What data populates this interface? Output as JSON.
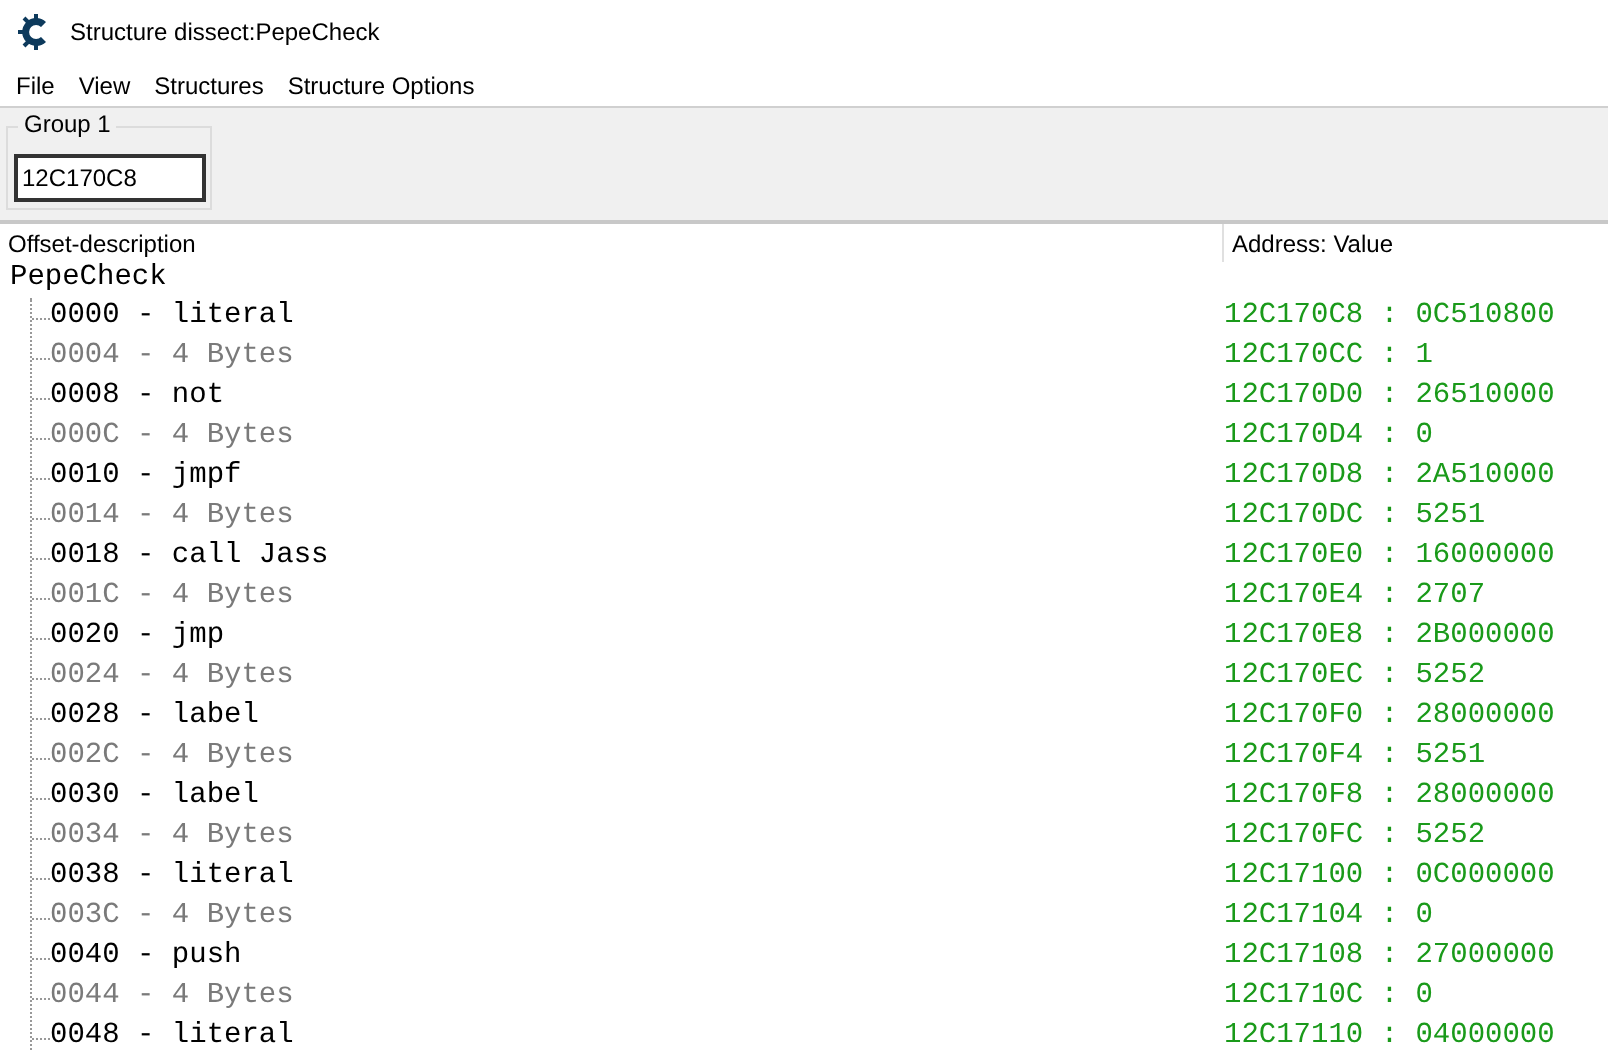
{
  "window": {
    "title": "Structure dissect:PepeCheck"
  },
  "menu": [
    "File",
    "View",
    "Structures",
    "Structure Options"
  ],
  "group": {
    "title": "Group 1",
    "address": "12C170C8"
  },
  "columns": [
    "Offset-description",
    "Address: Value"
  ],
  "tree": {
    "label": "PepeCheck",
    "children": [
      {
        "kind": "field",
        "label": "0000 - literal",
        "value": "12C170C8 : 0C510800"
      },
      {
        "kind": "padding",
        "label": "0004 - 4 Bytes",
        "value": "12C170CC : 1"
      },
      {
        "kind": "field",
        "label": "0008 - not",
        "value": "12C170D0 : 26510000"
      },
      {
        "kind": "padding",
        "label": "000C - 4 Bytes",
        "value": "12C170D4 : 0"
      },
      {
        "kind": "field",
        "label": "0010 - jmpf",
        "value": "12C170D8 : 2A510000"
      },
      {
        "kind": "padding",
        "label": "0014 - 4 Bytes",
        "value": "12C170DC : 5251"
      },
      {
        "kind": "field",
        "label": "0018 - call Jass",
        "value": "12C170E0 : 16000000"
      },
      {
        "kind": "padding",
        "label": "001C - 4 Bytes",
        "value": "12C170E4 : 2707"
      },
      {
        "kind": "field",
        "label": "0020 - jmp",
        "value": "12C170E8 : 2B000000"
      },
      {
        "kind": "padding",
        "label": "0024 - 4 Bytes",
        "value": "12C170EC : 5252"
      },
      {
        "kind": "field",
        "label": "0028 - label",
        "value": "12C170F0 : 28000000"
      },
      {
        "kind": "padding",
        "label": "002C - 4 Bytes",
        "value": "12C170F4 : 5251"
      },
      {
        "kind": "field",
        "label": "0030 - label",
        "value": "12C170F8 : 28000000"
      },
      {
        "kind": "padding",
        "label": "0034 - 4 Bytes",
        "value": "12C170FC : 5252"
      },
      {
        "kind": "field",
        "label": "0038 - literal",
        "value": "12C17100 : 0C000000"
      },
      {
        "kind": "padding",
        "label": "003C - 4 Bytes",
        "value": "12C17104 : 0"
      },
      {
        "kind": "field",
        "label": "0040 - push",
        "value": "12C17108 : 27000000"
      },
      {
        "kind": "padding",
        "label": "0044 - 4 Bytes",
        "value": "12C1710C : 0"
      },
      {
        "kind": "field",
        "label": "0048 - literal",
        "value": "12C17110 : 04000000"
      }
    ]
  }
}
